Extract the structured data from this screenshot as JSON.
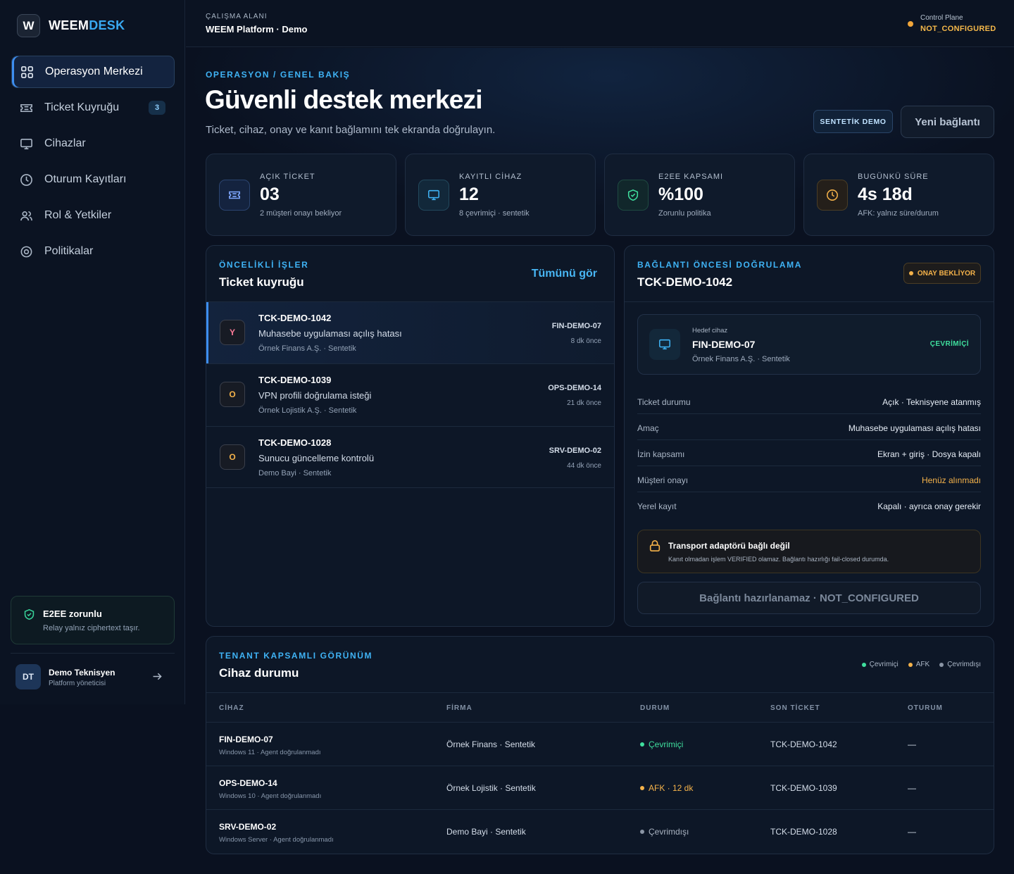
{
  "brand": {
    "logo_letter": "W",
    "name_part1": "WEEM",
    "name_part2": "DESK"
  },
  "sidebar": {
    "items": [
      {
        "label": "Operasyon Merkezi",
        "icon": "grid-icon",
        "active": true
      },
      {
        "label": "Ticket Kuyruğu",
        "icon": "ticket-icon",
        "badge": "3"
      },
      {
        "label": "Cihazlar",
        "icon": "monitor-icon"
      },
      {
        "label": "Oturum Kayıtları",
        "icon": "clock-icon"
      },
      {
        "label": "Rol & Yetkiler",
        "icon": "users-icon"
      },
      {
        "label": "Politikalar",
        "icon": "gear-icon"
      }
    ],
    "e2ee": {
      "title": "E2EE zorunlu",
      "subtitle": "Relay yalnız ciphertext taşır."
    },
    "user": {
      "initials": "DT",
      "name": "Demo Teknisyen",
      "role": "Platform yöneticisi"
    }
  },
  "topbar": {
    "workspace_label": "ÇALIŞMA ALANI",
    "workspace_name": "WEEM Platform · Demo",
    "control_plane_label": "Control Plane",
    "control_plane_status": "NOT_CONFIGURED"
  },
  "header": {
    "eyebrow": "OPERASYON / GENEL BAKIŞ",
    "title": "Güvenli destek merkezi",
    "subtitle": "Ticket, cihaz, onay ve kanıt bağlamını tek ekranda doğrulayın.",
    "demo_badge": "SENTETİK DEMO",
    "new_connection": "Yeni bağlantı"
  },
  "stats": [
    {
      "label": "AÇIK TİCKET",
      "value": "03",
      "sub": "2 müşteri onayı bekliyor",
      "icon": "ticket-icon"
    },
    {
      "label": "KAYITLI CİHAZ",
      "value": "12",
      "sub": "8 çevrimiçi · sentetik",
      "icon": "monitor-icon"
    },
    {
      "label": "E2EE KAPSAMI",
      "value": "%100",
      "sub": "Zorunlu politika",
      "icon": "shield-icon"
    },
    {
      "label": "BUGÜNKÜ SÜRE",
      "value": "4s 18d",
      "sub": "AFK: yalnız süre/durum",
      "icon": "clock-icon"
    }
  ],
  "queue": {
    "eyebrow": "ÖNCELİKLİ İŞLER",
    "title": "Ticket kuyruğu",
    "see_all": "Tümünü gör",
    "tickets": [
      {
        "priority": "Y",
        "id": "TCK-DEMO-1042",
        "desc": "Muhasebe uygulaması açılış hatası",
        "org": "Örnek Finans A.Ş. · Sentetik",
        "device": "FIN-DEMO-07",
        "time": "8 dk önce",
        "color": "#ff6b8a"
      },
      {
        "priority": "O",
        "id": "TCK-DEMO-1039",
        "desc": "VPN profili doğrulama isteği",
        "org": "Örnek Lojistik A.Ş. · Sentetik",
        "device": "OPS-DEMO-14",
        "time": "21 dk önce",
        "color": "#f4b24a"
      },
      {
        "priority": "O",
        "id": "TCK-DEMO-1028",
        "desc": "Sunucu güncelleme kontrolü",
        "org": "Demo Bayi · Sentetik",
        "device": "SRV-DEMO-02",
        "time": "44 dk önce",
        "color": "#f4b24a"
      }
    ]
  },
  "precheck": {
    "eyebrow": "BAĞLANTI ÖNCESİ DOĞRULAMA",
    "title": "TCK-DEMO-1042",
    "badge": "ONAY BEKLİYOR",
    "target": {
      "label": "Hedef cihaz",
      "name": "FIN-DEMO-07",
      "org": "Örnek Finans A.Ş. · Sentetik",
      "status": "ÇEVRİMİÇİ"
    },
    "rows": [
      {
        "key": "Ticket durumu",
        "value": "Açık · Teknisyene atanmış"
      },
      {
        "key": "Amaç",
        "value": "Muhasebe uygulaması açılış hatası"
      },
      {
        "key": "İzin kapsamı",
        "value": "Ekran + giriş · Dosya kapalı"
      },
      {
        "key": "Müşteri onayı",
        "value": "Henüz alınmadı",
        "warn": true
      },
      {
        "key": "Yerel kayıt",
        "value": "Kapalı · ayrıca onay gerekir"
      }
    ],
    "alert": {
      "title": "Transport adaptörü bağlı değil",
      "text": "Kanıt olmadan işlem VERIFIED olamaz. Bağlantı hazırlığı fail-closed durumda."
    },
    "button": "Bağlantı hazırlanamaz · NOT_CONFIGURED"
  },
  "devices": {
    "eyebrow": "TENANT KAPSAMLI GÖRÜNÜM",
    "title": "Cihaz durumu",
    "legend": [
      {
        "label": "Çevrimiçi",
        "color": "#3fdf9e"
      },
      {
        "label": "AFK",
        "color": "#f4b24a"
      },
      {
        "label": "Çevrimdışı",
        "color": "#8a95a5"
      }
    ],
    "columns": [
      "CİHAZ",
      "FİRMA",
      "DURUM",
      "SON TİCKET",
      "OTURUM"
    ],
    "rows": [
      {
        "device": "FIN-DEMO-07",
        "os": "Windows 11 · Agent doğrulanmadı",
        "company": "Örnek Finans · Sentetik",
        "status": "Çevrimiçi",
        "status_color": "#3fdf9e",
        "ticket": "TCK-DEMO-1042",
        "session": "—"
      },
      {
        "device": "OPS-DEMO-14",
        "os": "Windows 10 · Agent doğrulanmadı",
        "company": "Örnek Lojistik · Sentetik",
        "status": "AFK · 12 dk",
        "status_color": "#f4b24a",
        "ticket": "TCK-DEMO-1039",
        "session": "—"
      },
      {
        "device": "SRV-DEMO-02",
        "os": "Windows Server · Agent doğrulanmadı",
        "company": "Demo Bayi · Sentetik",
        "status": "Çevrimdışı",
        "status_color": "#8a95a5",
        "ticket": "TCK-DEMO-1028",
        "session": "—"
      }
    ]
  }
}
